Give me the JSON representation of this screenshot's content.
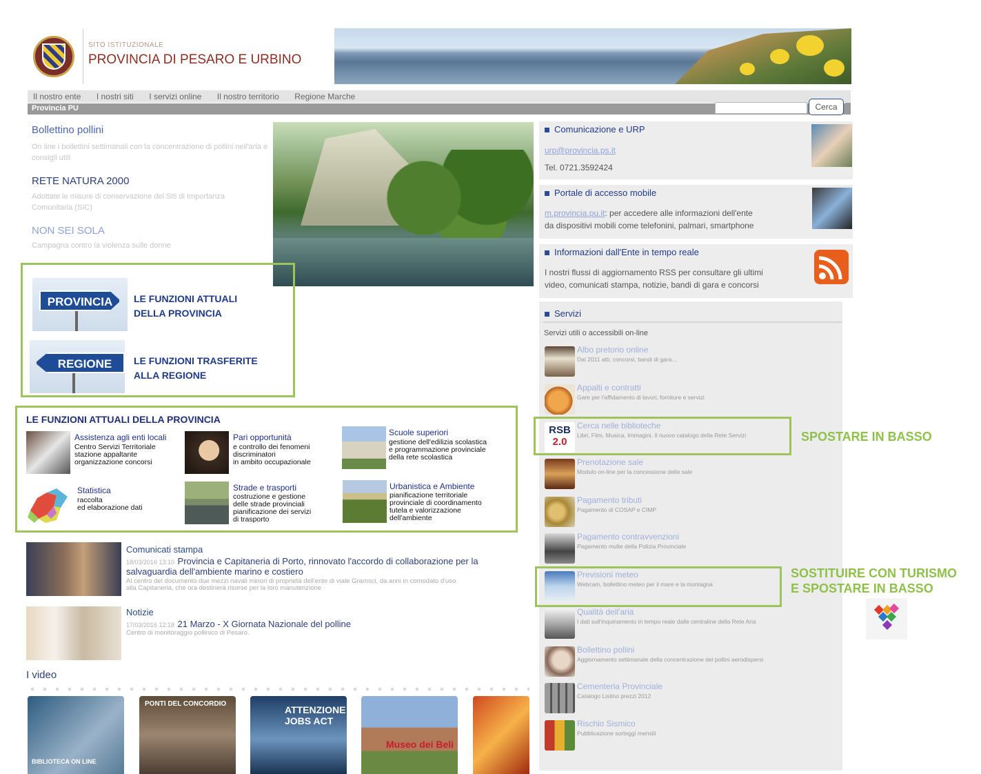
{
  "header": {
    "site_subtitle": "SITO ISTITUZIONALE",
    "site_title": "PROVINCIA DI PESARO E URBINO"
  },
  "nav": {
    "items": [
      "Il nostro ente",
      "I nostri siti",
      "I servizi online",
      "Il nostro territorio",
      "Regione Marche"
    ]
  },
  "breadcrumb": "Provincia PU",
  "search": {
    "button": "Cerca",
    "placeholder": ""
  },
  "left_links": [
    {
      "title": "Bollettino pollini",
      "desc": "On line i bollettini settimanali con la concentrazione di pollini nell'aria e consigli utili"
    },
    {
      "title": "RETE NATURA 2000",
      "desc": "Adottate le misure di conservazione dei Siti di Importanza Comunitaria (SIC)"
    },
    {
      "title": "NON SEI SOLA",
      "desc": "Campagna contro la violenza sulle donne"
    }
  ],
  "signs": {
    "provincia": {
      "sign": "PROVINCIA",
      "label_1": "LE FUNZIONI ATTUALI",
      "label_2": "DELLA PROVINCIA"
    },
    "regione": {
      "sign": "REGIONE",
      "label_1": "LE FUNZIONI TRASFERITE",
      "label_2": "ALLA REGIONE"
    }
  },
  "functions": {
    "title": "LE FUNZIONI ATTUALI DELLA PROVINCIA",
    "items": [
      {
        "title": "Assistenza agli enti locali",
        "lines": [
          "Centro Servizi Territoriale",
          "stazione appaltante",
          "organizzazione concorsi"
        ]
      },
      {
        "title": "Pari opportunità",
        "lines": [
          "e controllo dei fenomeni",
          "discriminatori",
          "in ambito occupazionale"
        ]
      },
      {
        "title": "Scuole superiori",
        "lines": [
          "gestione dell'edilizia scolastica",
          "e programmazione provinciale",
          "della rete scolastica"
        ]
      },
      {
        "title": "Statistica",
        "lines": [
          "raccolta",
          "ed elaborazione dati"
        ]
      },
      {
        "title": "Strade e trasporti",
        "lines": [
          "costruzione  e gestione",
          "delle strade provinciali",
          "pianificazione dei servizi",
          "di trasporto"
        ]
      },
      {
        "title": "Urbanistica e Ambiente",
        "lines": [
          "pianificazione  territoriale",
          "provinciale di coordinamento",
          "tutela e valorizzazione",
          "dell'ambiente"
        ]
      }
    ]
  },
  "news": [
    {
      "section": "Comunicati stampa",
      "date": "18/03/2016 13:10",
      "title_1": "Provincia e Capitaneria di Porto, rinnovato l'accordo di collaborazione per la",
      "title_2": "salvaguardia dell'ambiente marino e costiero",
      "desc_1": "Al centro del documento due mezzi navali minori di proprietà dell'ente di viale Gramsci, da anni in comodato d'uso",
      "desc_2": "alla Capitaneria, che ora destinerà risorse per la loro manutenzione"
    },
    {
      "section": "Notizie",
      "date": "17/03/2016 12:18",
      "title_1": "21 Marzo - X Giornata Nazionale del polline",
      "title_2": "",
      "desc_1": "Centro di monitoraggio pollinico di Pesaro.",
      "desc_2": ""
    }
  ],
  "videos": {
    "title": "I video",
    "thumbs": [
      "BIBLIOTECA ON LINE",
      "PONTI DEL CONCORDIO",
      "ATTENZIONE JOBS ACT",
      "Museo dei Beli",
      ""
    ]
  },
  "right": {
    "urp": {
      "title": "Comunicazione e URP",
      "email": "urp@provincia.ps.it",
      "tel": "Tel. 0721.3592424"
    },
    "mobile": {
      "title": "Portale di accesso mobile",
      "link": "m.provincia.pu.it",
      "text_1": ": per accedere alle informazioni dell'ente",
      "text_2": "da dispositivi mobili come telefonini, palmari, smartphone"
    },
    "rss": {
      "title": "Informazioni dall'Ente in tempo reale",
      "text_1": "I nostri flussi di aggiornamento RSS per consultare gli ultimi",
      "text_2": "video, comunicati stampa, notizie, bandi di gara e concorsi"
    },
    "services": {
      "title": "Servizi",
      "subtitle": "Servizi utili o accessibili on-line",
      "items": [
        {
          "title": "Albo pretorio online",
          "desc": "Dal 2011 atti, concorsi, bandi di gara..."
        },
        {
          "title": "Appalti e contratti",
          "desc": "Gare per l'affidamento di lavori, forniture e servizi"
        },
        {
          "title": "Cerca nelle biblioteche",
          "desc": "Libri, Film, Musica, Immagini. Il nuovo catalogo della Rete Servizi"
        },
        {
          "title": "Prenotazione sale",
          "desc": "Modulo on-line per la concessione delle sale"
        },
        {
          "title": "Pagamento tributi",
          "desc": "Pagamento di COSAP e CIMP"
        },
        {
          "title": "Pagamento contravvenzioni",
          "desc": "Pagamento multe della Polizia Provinciale"
        },
        {
          "title": "Previsioni meteo",
          "desc": "Webcam, bollettino meteo per il mare e la montagna"
        },
        {
          "title": "Qualità dell'aria",
          "desc": "I dati sull'inquinamento in tempo reale dalle centraline della Rete Aria"
        },
        {
          "title": "Bollettino pollini",
          "desc": "Aggiornamento settimanale della concentrazione dei pollini aerodispersi"
        },
        {
          "title": "Cementeria Provinciale",
          "desc": "Catalogo Listino prezzi 2012"
        },
        {
          "title": "Rischio Sismico",
          "desc": "Pubblicazione sorteggi mensili"
        }
      ]
    },
    "rsb_logo_1": "RSB",
    "rsb_logo_2": "2.0"
  },
  "annotations": {
    "move_down": "SPOSTARE IN BASSO",
    "replace_1": "SOSTITUIRE CON TURISMO",
    "replace_2": "E SPOSTARE IN BASSO"
  },
  "colors": {
    "accent_green": "#9dc45a",
    "title_red": "#8c2e22",
    "nav_blue": "#1f3a8a"
  }
}
